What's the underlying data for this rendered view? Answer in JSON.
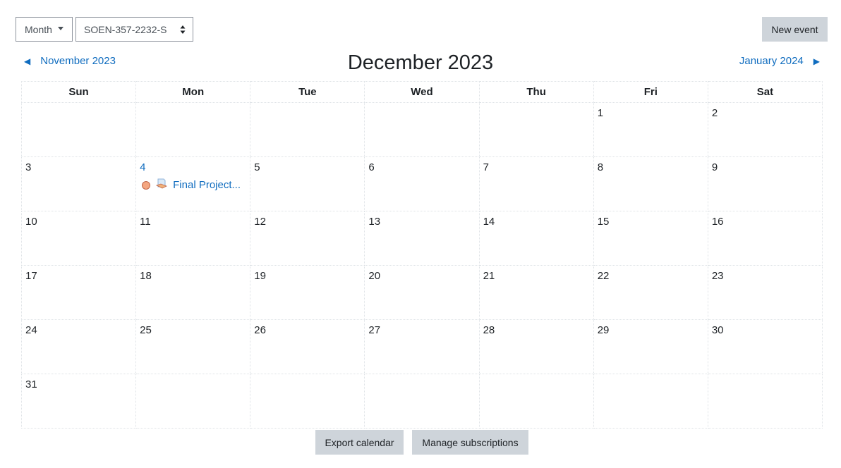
{
  "controls": {
    "view": "Month",
    "course": "SOEN-357-2232-S",
    "new_event": "New event"
  },
  "nav": {
    "prev": "November 2023",
    "current": "December 2023",
    "next": "January 2024"
  },
  "weekdays": [
    "Sun",
    "Mon",
    "Tue",
    "Wed",
    "Thu",
    "Fri",
    "Sat"
  ],
  "weeks": [
    [
      "",
      "",
      "",
      "",
      "",
      "1",
      "2"
    ],
    [
      "3",
      "4",
      "5",
      "6",
      "7",
      "8",
      "9"
    ],
    [
      "10",
      "11",
      "12",
      "13",
      "14",
      "15",
      "16"
    ],
    [
      "17",
      "18",
      "19",
      "20",
      "21",
      "22",
      "23"
    ],
    [
      "24",
      "25",
      "26",
      "27",
      "28",
      "29",
      "30"
    ],
    [
      "31",
      "",
      "",
      "",
      "",
      "",
      ""
    ]
  ],
  "events": [
    {
      "day": "4",
      "title": "Final Project...",
      "icon": "assignment-icon",
      "color": "#f4a680"
    }
  ],
  "footer": {
    "export": "Export calendar",
    "manage": "Manage subscriptions"
  },
  "colors": {
    "link": "#0f6cbf",
    "button": "#ced4da"
  }
}
